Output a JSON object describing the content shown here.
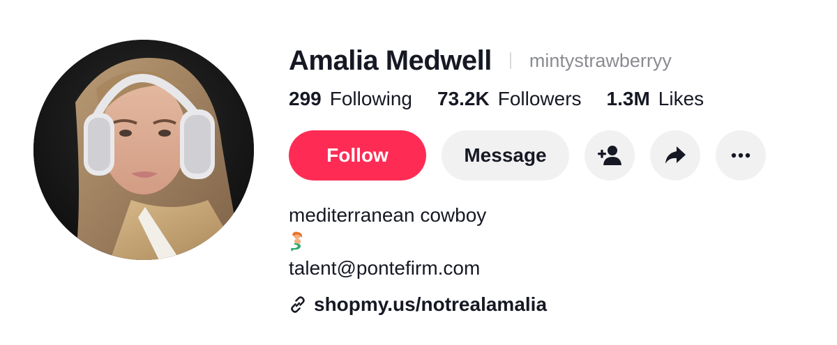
{
  "profile": {
    "display_name": "Amalia Medwell",
    "username": "mintystrawberryy",
    "avatar_alt": "profile-photo"
  },
  "stats": [
    {
      "value": "299",
      "label": "Following"
    },
    {
      "value": "73.2K",
      "label": "Followers"
    },
    {
      "value": "1.3M",
      "label": "Likes"
    }
  ],
  "actions": {
    "follow_label": "Follow",
    "message_label": "Message",
    "add_friend_icon": "person-plus-icon",
    "share_icon": "share-arrow-icon",
    "more_icon": "ellipsis-icon"
  },
  "bio": {
    "line1": "mediterranean cowboy",
    "emoji": "mermaid-emoji",
    "line3": "talent@pontefirm.com",
    "link": "shopmy.us/notrealamalia"
  },
  "colors": {
    "accent": "#fe2c55",
    "button_gray": "#f1f1f2",
    "text": "#161823",
    "muted": "#8a8b91"
  }
}
